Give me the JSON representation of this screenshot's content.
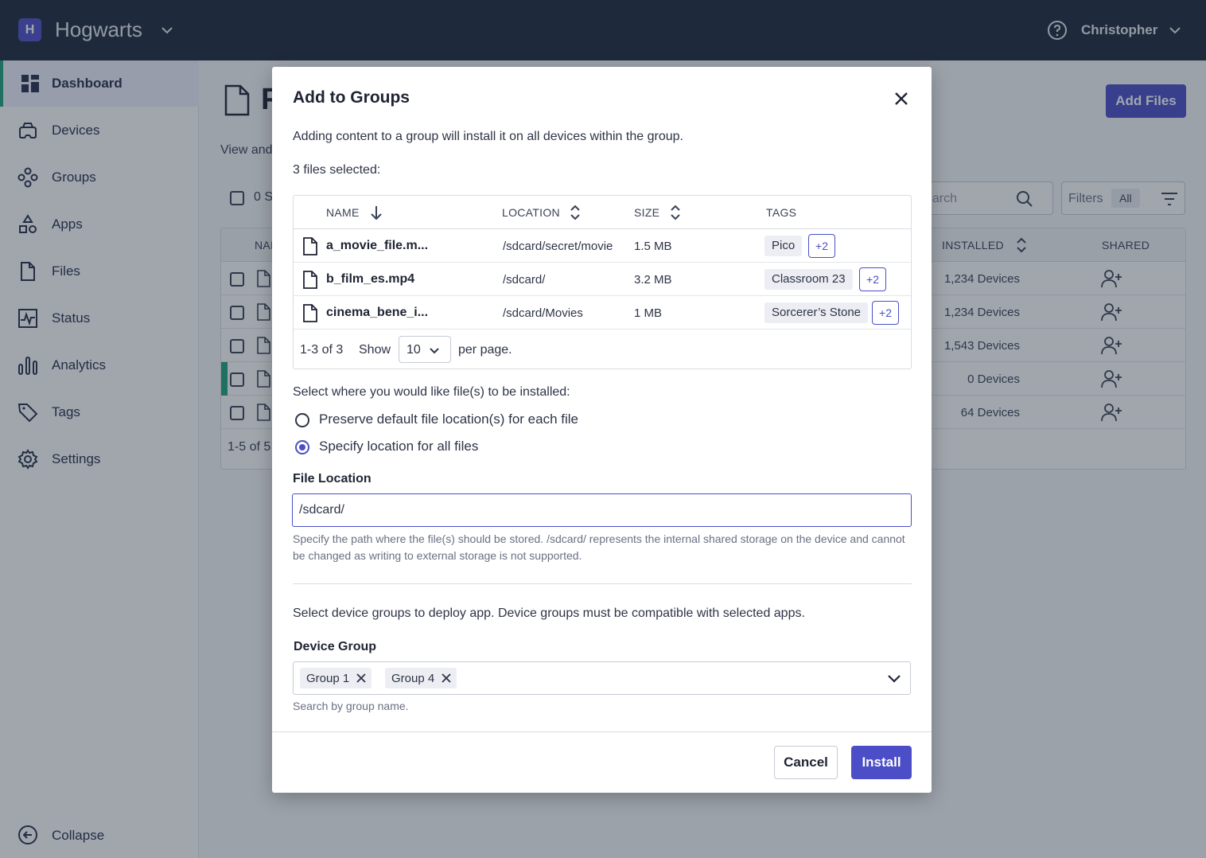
{
  "topbar": {
    "org_initial": "H",
    "org_name": "Hogwarts",
    "user_name": "Christopher"
  },
  "sidebar": {
    "items": [
      {
        "label": "Dashboard",
        "icon": "dashboard-icon",
        "active": true
      },
      {
        "label": "Devices",
        "icon": "headset-icon"
      },
      {
        "label": "Groups",
        "icon": "groups-icon"
      },
      {
        "label": "Apps",
        "icon": "apps-icon"
      },
      {
        "label": "Files",
        "icon": "file-icon"
      },
      {
        "label": "Status",
        "icon": "status-icon"
      },
      {
        "label": "Analytics",
        "icon": "analytics-icon"
      },
      {
        "label": "Tags",
        "icon": "tag-icon"
      },
      {
        "label": "Settings",
        "icon": "gear-icon"
      }
    ],
    "collapse_label": "Collapse"
  },
  "page": {
    "title": "F",
    "subtitle": "View and",
    "add_files_label": "Add Files",
    "selected_count": "0 S",
    "search_placeholder": "earch",
    "filters_label": "Filters",
    "filters_value": "All",
    "table": {
      "columns": {
        "name": "NAI",
        "installed": "INSTALLED",
        "shared": "SHARED"
      },
      "rows": [
        {
          "installed": "1,234 Devices"
        },
        {
          "installed": "1,234 Devices"
        },
        {
          "installed": "1,543 Devices"
        },
        {
          "installed": "0 Devices"
        },
        {
          "installed": "64 Devices"
        }
      ],
      "footer": "1-5 of 5"
    }
  },
  "modal": {
    "title": "Add to Groups",
    "description": "Adding content to a group will install it on all devices within the group.",
    "selected_text": "3 files selected:",
    "columns": {
      "name": "NAME",
      "location": "LOCATION",
      "size": "SIZE",
      "tags": "TAGS"
    },
    "files": [
      {
        "name": "a_movie_file.m...",
        "location": "/sdcard/secret/movie",
        "size": "1.5 MB",
        "tag": "Pico",
        "more": "+2"
      },
      {
        "name": "b_film_es.mp4",
        "location": "/sdcard/",
        "size": "3.2 MB",
        "tag": "Classroom 23",
        "more": "+2"
      },
      {
        "name": "cinema_bene_i...",
        "location": "/sdcard/Movies",
        "size": "1 MB",
        "tag": "Sorcerer’s Stone",
        "more": "+2"
      }
    ],
    "pagination": {
      "range": "1-3 of 3",
      "show": "Show",
      "per_page_value": "10",
      "per_page": "per page."
    },
    "install_question": "Select where you would like file(s) to be installed:",
    "options": [
      {
        "label": "Preserve default file location(s) for each file",
        "selected": false
      },
      {
        "label": "Specify location for all files",
        "selected": true
      }
    ],
    "file_location_label": "File Location",
    "file_location_value": "/sdcard/",
    "file_location_help": "Specify the path where the file(s) should be stored. /sdcard/ represents the internal shared storage on the device and cannot be changed as writing to external storage is not supported.",
    "device_group_desc": "Select device groups to deploy app. Device groups must be compatible with selected apps.",
    "device_group_label": "Device Group",
    "device_groups": [
      "Group 1",
      "Group 4"
    ],
    "device_group_help": "Search by group name.",
    "cancel_label": "Cancel",
    "install_label": "Install"
  },
  "colors": {
    "primary": "#4b4ec6",
    "topbar": "#1e2a3b",
    "accent_green": "#1fa37c"
  }
}
